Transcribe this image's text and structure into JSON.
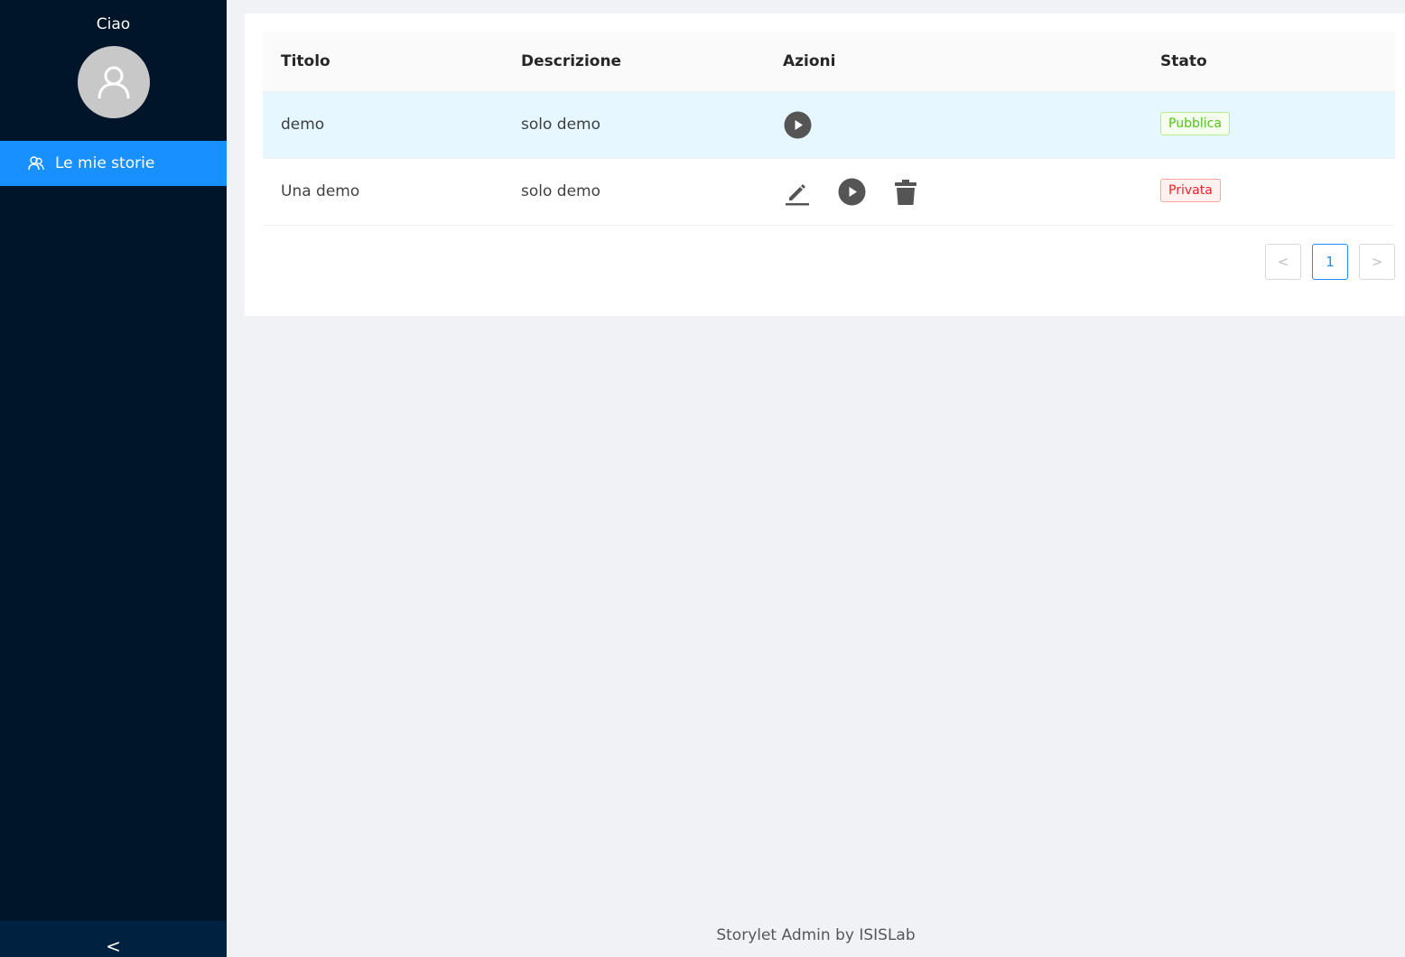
{
  "sidebar": {
    "greeting": "Ciao",
    "menu": [
      {
        "label": "Le mie storie",
        "icon": "users-icon",
        "active": true
      }
    ],
    "collapse_label": "<"
  },
  "table": {
    "columns": [
      "Titolo",
      "Descrizione",
      "Azioni",
      "Stato"
    ],
    "rows": [
      {
        "title": "demo",
        "description": "solo demo",
        "actions": [
          "play-icon"
        ],
        "status": "Pubblica",
        "status_color": "#52c41a"
      },
      {
        "title": "Una demo",
        "description": "solo demo",
        "actions": [
          "edit-icon",
          "play-icon",
          "delete-icon"
        ],
        "status": "Privata",
        "status_color": "#f5222d"
      }
    ]
  },
  "pagination": {
    "prev": "<",
    "current": "1",
    "next": ">"
  },
  "footer": "Storylet Admin by ISISLab",
  "colors": {
    "sidebar": "#001529",
    "accent": "#1890ff",
    "row_highlight": "#e6f7ff"
  }
}
